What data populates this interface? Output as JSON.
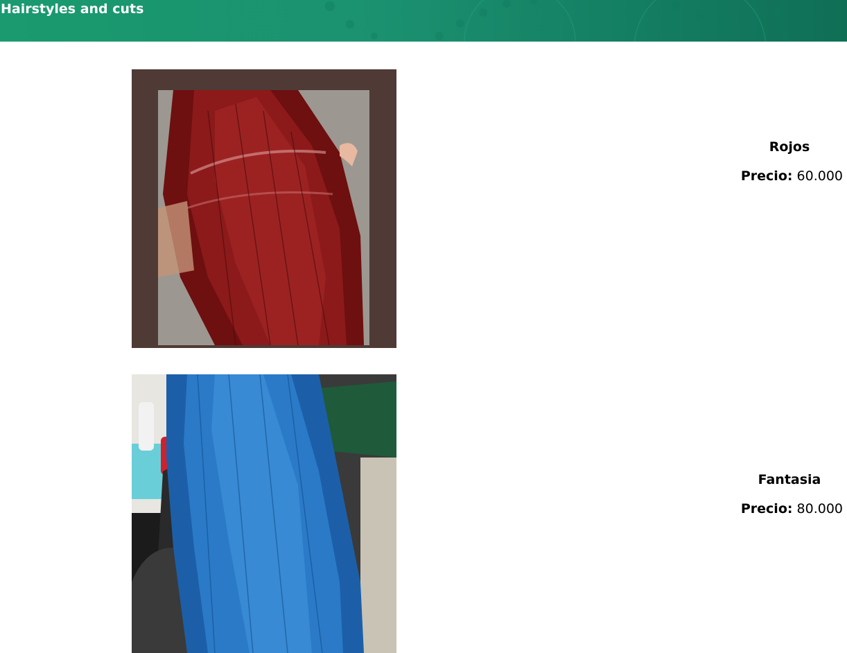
{
  "header": {
    "title": "Hairstyles and cuts",
    "color": "#1a9a6e"
  },
  "products": [
    {
      "name": "Rojos",
      "price_label": "Precio:",
      "price_value": "60.000",
      "image_subject": "long straight red-dyed hair",
      "image_color": "#7a1212"
    },
    {
      "name": "Fantasia",
      "price_label": "Precio:",
      "price_value": "80.000",
      "image_subject": "long straight blue-dyed hair",
      "image_color": "#1f6bb8"
    }
  ]
}
